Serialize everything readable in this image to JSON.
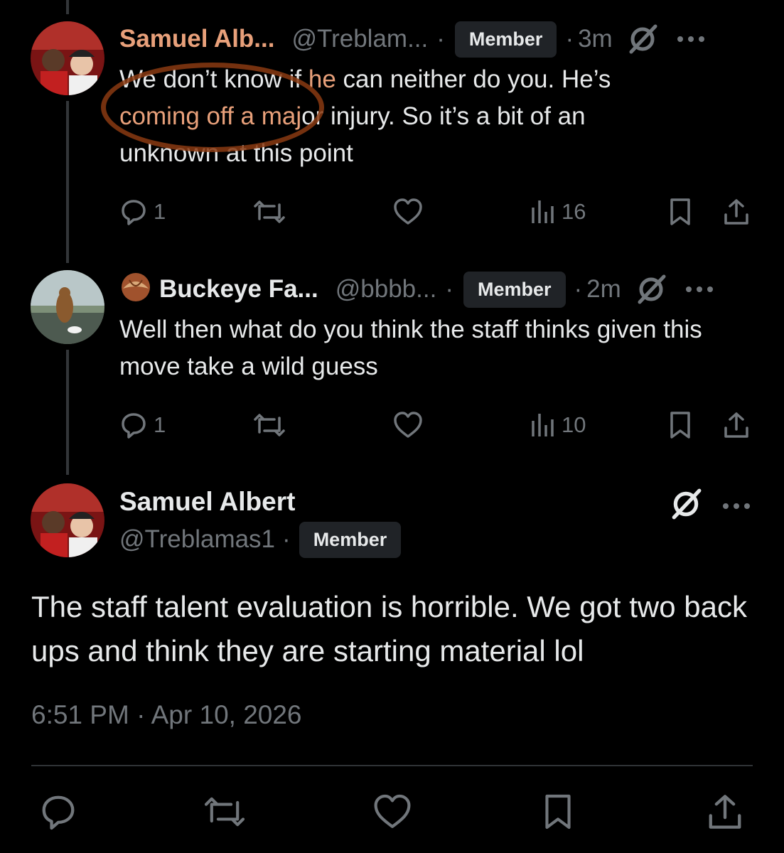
{
  "tweets": [
    {
      "name": "Samuel Alb...",
      "handle": "@Treblam...",
      "badge": "Member",
      "time": "3m",
      "text_before": "We don’t know if ",
      "text_highlight_1": "he",
      "text_mid": " can neither do you. He’s ",
      "text_highlight_2": "coming off a maj",
      "text_after": "or injury. So it’s a bit of an unknown at this point",
      "replies": "1",
      "views": "16"
    },
    {
      "name": "Buckeye Fa...",
      "handle": "@bbbb...",
      "badge": "Member",
      "time": "2m",
      "text": "Well then what do you think the staff thinks given this move take a wild guess",
      "replies": "1",
      "views": "10"
    }
  ],
  "main": {
    "name": "Samuel Albert",
    "handle": "@Treblamas1",
    "badge": "Member",
    "text": "The staff talent evaluation is horrible. We got two back ups and think they are starting material lol",
    "timestamp": "6:51 PM · Apr 10, 2026"
  },
  "dot": "·",
  "colors": {
    "background": "#000000",
    "text": "#e7e9ea",
    "muted": "#71767b",
    "badge_bg": "#202327",
    "highlight": "#e8a07a",
    "annotation": "#8a3a12"
  },
  "icons": [
    "reply-icon",
    "retweet-icon",
    "like-icon",
    "views-icon",
    "bookmark-icon",
    "share-icon",
    "verified-icon",
    "more-icon"
  ]
}
